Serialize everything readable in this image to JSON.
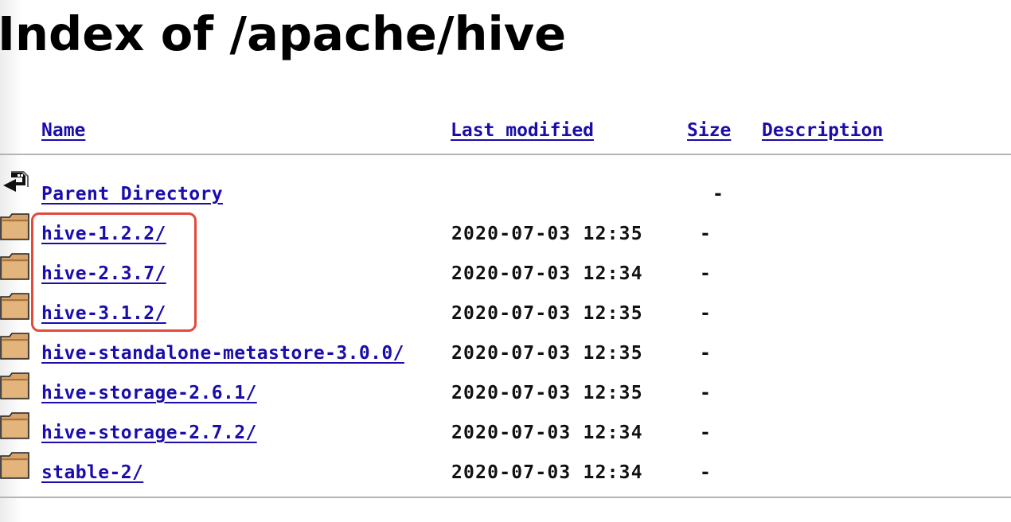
{
  "title": "Index of /apache/hive",
  "columns": {
    "name": "Name",
    "last_modified": "Last modified",
    "size": "Size",
    "description": "Description"
  },
  "parent": {
    "name": "Parent Directory",
    "size": "-",
    "icon": "back-arrow-icon"
  },
  "rows": [
    {
      "name": "hive-1.2.2/",
      "date": "2020-07-03 12:35",
      "size": "-",
      "icon": "folder-icon"
    },
    {
      "name": "hive-2.3.7/",
      "date": "2020-07-03 12:34",
      "size": "-",
      "icon": "folder-icon"
    },
    {
      "name": "hive-3.1.2/",
      "date": "2020-07-03 12:35",
      "size": "-",
      "icon": "folder-icon"
    },
    {
      "name": "hive-standalone-metastore-3.0.0/",
      "date": "2020-07-03 12:35",
      "size": "-",
      "icon": "folder-icon"
    },
    {
      "name": "hive-storage-2.6.1/",
      "date": "2020-07-03 12:35",
      "size": "-",
      "icon": "folder-icon"
    },
    {
      "name": "hive-storage-2.7.2/",
      "date": "2020-07-03 12:34",
      "size": "-",
      "icon": "folder-icon"
    },
    {
      "name": "stable-2/",
      "date": "2020-07-03 12:34",
      "size": "-",
      "icon": "folder-icon"
    }
  ],
  "colors": {
    "link": "#1a0dab",
    "highlight": "#e14b3c",
    "rule": "#b5b5b5"
  }
}
